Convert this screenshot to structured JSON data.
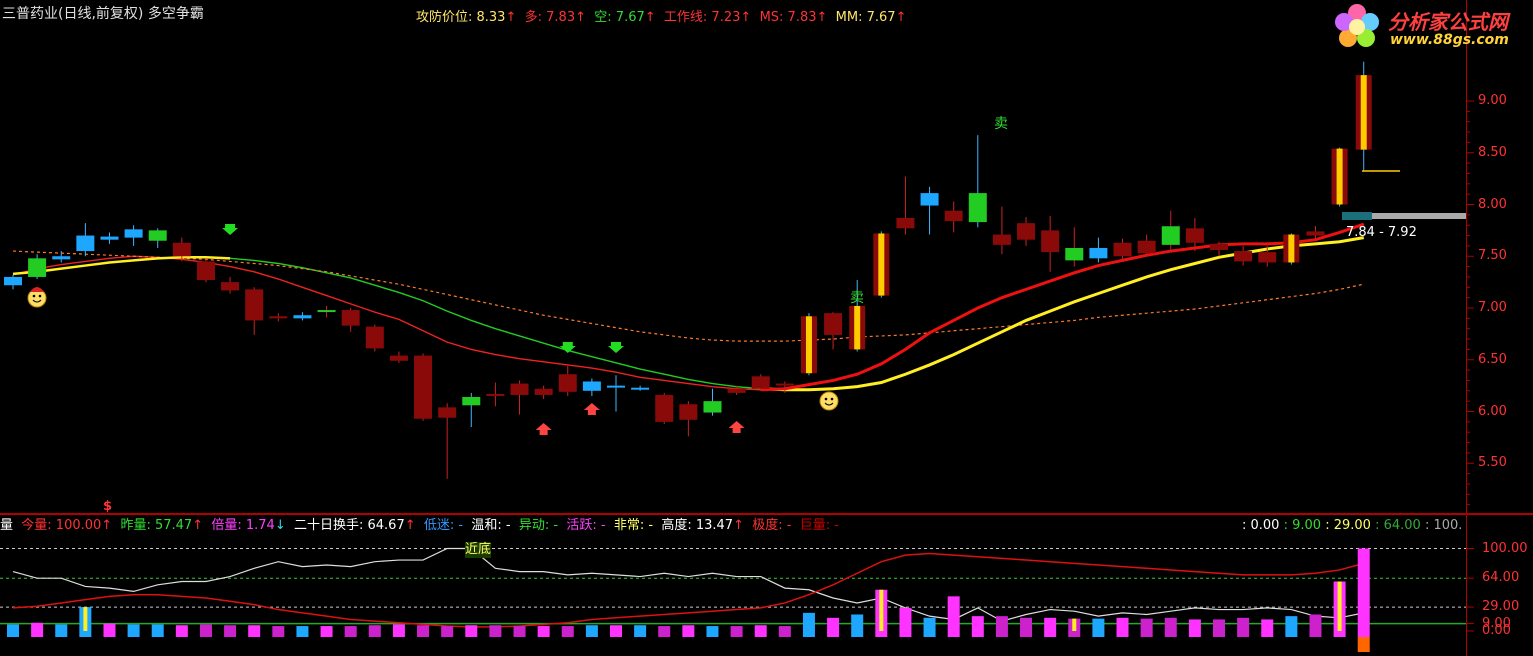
{
  "header": {
    "title": "三普药业(日线,前复权) 多空争霸",
    "indicators": [
      {
        "label": "攻防价位: 8.33",
        "arrow": "↑",
        "color": "#ffe66a"
      },
      {
        "label": "多: 7.83",
        "arrow": "↑",
        "color": "#ff3333"
      },
      {
        "label": "空: 7.67",
        "arrow": "↑",
        "color": "#33dd33"
      },
      {
        "label": "工作线: 7.23",
        "arrow": "↑",
        "color": "#ff3333"
      },
      {
        "label": "MS: 7.83",
        "arrow": "↑",
        "color": "#ff3333"
      },
      {
        "label": "MM: 7.67",
        "arrow": "↑",
        "color": "#ffe66a"
      }
    ]
  },
  "logo": {
    "name": "分析家公式网",
    "url": "www.88gs.com"
  },
  "price_axis": {
    "ticks": [
      "9.00",
      "8.50",
      "8.00",
      "7.50",
      "7.00",
      "6.50",
      "6.00",
      "5.50"
    ]
  },
  "range_label": "7.84 - 7.92",
  "signals": {
    "sell1": "卖",
    "sell2": "卖",
    "dollar": "$",
    "near_bottom": "近底"
  },
  "volume_header": {
    "prefix": "量",
    "items": [
      {
        "label": "今量: 100.00",
        "arrow": "↑",
        "color": "#ff3333",
        "arrow_color": "#ff3333"
      },
      {
        "label": "昨量: 57.47",
        "arrow": "↑",
        "color": "#33dd33",
        "arrow_color": "#ff3333"
      },
      {
        "label": "倍量: 1.74",
        "arrow": "↓",
        "color": "#ff40ff",
        "arrow_color": "#33dddd"
      },
      {
        "label": "二十日换手: 64.67",
        "arrow": "↑",
        "color": "#ffffff",
        "arrow_color": "#ff3333"
      },
      {
        "label": "低迷: -",
        "arrow": "",
        "color": "#3399ff",
        "arrow_color": ""
      },
      {
        "label": "温和: -",
        "arrow": "",
        "color": "#ffffff",
        "arrow_color": ""
      },
      {
        "label": "异动: -",
        "arrow": "",
        "color": "#33dd33",
        "arrow_color": ""
      },
      {
        "label": "活跃: -",
        "arrow": "",
        "color": "#ff40ff",
        "arrow_color": ""
      },
      {
        "label": "非常: -",
        "arrow": "",
        "color": "#ffff66",
        "arrow_color": ""
      },
      {
        "label": "高度: 13.47",
        "arrow": "↑",
        "color": "#ffffff",
        "arrow_color": "#ff3333"
      },
      {
        "label": "极度: -",
        "arrow": "",
        "color": "#ff3333",
        "arrow_color": ""
      },
      {
        "label": "巨量: -",
        "arrow": "",
        "color": "#cc0000",
        "arrow_color": ""
      }
    ],
    "right_values": [
      {
        "label": ": 0.00",
        "color": "#ffffff"
      },
      {
        "label": ": 9.00",
        "color": "#33dd33"
      },
      {
        "label": ": 29.00",
        "color": "#ffff66"
      },
      {
        "label": ": 64.00",
        "color": "#33aa33"
      },
      {
        "label": ": 100.",
        "color": "#aaaaaa"
      }
    ]
  },
  "volume_axis": {
    "ticks": [
      "100.00",
      "64.00",
      "29.00",
      "9.00",
      "0.00"
    ]
  },
  "chart_data": {
    "type": "candlestick",
    "y_range": [
      5.5,
      9.0
    ],
    "candles": [
      {
        "o": 7.22,
        "c": 7.3,
        "h": 7.32,
        "l": 7.18
      },
      {
        "o": 7.3,
        "c": 7.48,
        "h": 7.52,
        "l": 7.28
      },
      {
        "o": 7.47,
        "c": 7.5,
        "h": 7.55,
        "l": 7.44
      },
      {
        "o": 7.55,
        "c": 7.7,
        "h": 7.82,
        "l": 7.5
      },
      {
        "o": 7.66,
        "c": 7.69,
        "h": 7.73,
        "l": 7.62
      },
      {
        "o": 7.68,
        "c": 7.76,
        "h": 7.8,
        "l": 7.6
      },
      {
        "o": 7.65,
        "c": 7.75,
        "h": 7.77,
        "l": 7.58
      },
      {
        "o": 7.63,
        "c": 7.5,
        "h": 7.68,
        "l": 7.45
      },
      {
        "o": 7.45,
        "c": 7.27,
        "h": 7.48,
        "l": 7.25
      },
      {
        "o": 7.25,
        "c": 7.17,
        "h": 7.3,
        "l": 7.14
      },
      {
        "o": 7.18,
        "c": 6.88,
        "h": 7.2,
        "l": 6.74
      },
      {
        "o": 6.92,
        "c": 6.9,
        "h": 6.95,
        "l": 6.87
      },
      {
        "o": 6.9,
        "c": 6.93,
        "h": 6.96,
        "l": 6.88
      },
      {
        "o": 6.98,
        "c": 6.97,
        "h": 7.02,
        "l": 6.91
      },
      {
        "o": 6.98,
        "c": 6.83,
        "h": 7.0,
        "l": 6.77
      },
      {
        "o": 6.82,
        "c": 6.61,
        "h": 6.84,
        "l": 6.58
      },
      {
        "o": 6.54,
        "c": 6.49,
        "h": 6.58,
        "l": 6.47
      },
      {
        "o": 6.54,
        "c": 5.93,
        "h": 6.56,
        "l": 5.91
      },
      {
        "o": 6.04,
        "c": 5.94,
        "h": 6.08,
        "l": 5.35
      },
      {
        "o": 6.06,
        "c": 6.14,
        "h": 6.18,
        "l": 5.85
      },
      {
        "o": 6.17,
        "c": 6.15,
        "h": 6.28,
        "l": 6.05
      },
      {
        "o": 6.27,
        "c": 6.16,
        "h": 6.3,
        "l": 5.97
      },
      {
        "o": 6.22,
        "c": 6.16,
        "h": 6.25,
        "l": 6.12
      },
      {
        "o": 6.36,
        "c": 6.19,
        "h": 6.44,
        "l": 6.15
      },
      {
        "o": 6.2,
        "c": 6.29,
        "h": 6.32,
        "l": 6.15
      },
      {
        "o": 6.24,
        "c": 6.25,
        "h": 6.35,
        "l": 6.0
      },
      {
        "o": 6.22,
        "c": 6.23,
        "h": 6.25,
        "l": 6.2
      },
      {
        "o": 6.16,
        "c": 5.9,
        "h": 6.18,
        "l": 5.88
      },
      {
        "o": 6.07,
        "c": 5.92,
        "h": 6.1,
        "l": 5.76
      },
      {
        "o": 5.99,
        "c": 6.1,
        "h": 6.22,
        "l": 5.96
      },
      {
        "o": 6.22,
        "c": 6.18,
        "h": 6.25,
        "l": 6.16
      },
      {
        "o": 6.34,
        "c": 6.22,
        "h": 6.36,
        "l": 6.2
      },
      {
        "o": 6.27,
        "c": 6.26,
        "h": 6.29,
        "l": 6.18
      },
      {
        "o": 6.37,
        "c": 6.92,
        "h": 6.95,
        "l": 6.35
      },
      {
        "o": 6.95,
        "c": 6.74,
        "h": 6.96,
        "l": 6.6
      },
      {
        "o": 6.6,
        "c": 7.02,
        "h": 7.27,
        "l": 6.58
      },
      {
        "o": 7.12,
        "c": 7.72,
        "h": 7.74,
        "l": 7.1
      },
      {
        "o": 7.87,
        "c": 7.77,
        "h": 8.27,
        "l": 7.71
      },
      {
        "o": 7.99,
        "c": 8.11,
        "h": 8.17,
        "l": 7.71
      },
      {
        "o": 7.94,
        "c": 7.84,
        "h": 8.03,
        "l": 7.73
      },
      {
        "o": 7.83,
        "c": 8.11,
        "h": 8.67,
        "l": 7.78
      },
      {
        "o": 7.71,
        "c": 7.61,
        "h": 7.98,
        "l": 7.52
      },
      {
        "o": 7.82,
        "c": 7.66,
        "h": 7.88,
        "l": 7.6
      },
      {
        "o": 7.75,
        "c": 7.54,
        "h": 7.89,
        "l": 7.35
      },
      {
        "o": 7.58,
        "c": 7.46,
        "h": 7.78,
        "l": 7.4
      },
      {
        "o": 7.48,
        "c": 7.58,
        "h": 7.68,
        "l": 7.44
      },
      {
        "o": 7.63,
        "c": 7.5,
        "h": 7.67,
        "l": 7.45
      },
      {
        "o": 7.65,
        "c": 7.53,
        "h": 7.71,
        "l": 7.5
      },
      {
        "o": 7.79,
        "c": 7.61,
        "h": 7.94,
        "l": 7.55
      },
      {
        "o": 7.77,
        "c": 7.63,
        "h": 7.87,
        "l": 7.55
      },
      {
        "o": 7.62,
        "c": 7.56,
        "h": 7.64,
        "l": 7.5
      },
      {
        "o": 7.55,
        "c": 7.45,
        "h": 7.6,
        "l": 7.41
      },
      {
        "o": 7.54,
        "c": 7.44,
        "h": 7.6,
        "l": 7.4
      },
      {
        "o": 7.44,
        "c": 7.71,
        "h": 7.72,
        "l": 7.42
      },
      {
        "o": 7.74,
        "c": 7.7,
        "h": 7.79,
        "l": 7.65
      },
      {
        "o": 8.0,
        "c": 8.54,
        "h": 8.55,
        "l": 7.98
      },
      {
        "o": 8.53,
        "c": 9.25,
        "h": 9.38,
        "l": 8.33
      }
    ],
    "series": [
      {
        "name": "多",
        "values": [
          7.32,
          7.38,
          7.42,
          7.45,
          7.48,
          7.5,
          7.49,
          7.47,
          7.44,
          7.4,
          7.35,
          7.28,
          7.2,
          7.12,
          7.04,
          6.96,
          6.89,
          6.78,
          6.67,
          6.6,
          6.55,
          6.51,
          6.48,
          6.45,
          6.42,
          6.38,
          6.33,
          6.3,
          6.27,
          6.24,
          6.22,
          6.21,
          6.22,
          6.26,
          6.3,
          6.36,
          6.46,
          6.6,
          6.76,
          6.88,
          7.0,
          7.1,
          7.18,
          7.26,
          7.34,
          7.41,
          7.46,
          7.51,
          7.55,
          7.58,
          7.61,
          7.62,
          7.62,
          7.63,
          7.66,
          7.73,
          7.81
        ]
      },
      {
        "name": "空",
        "values": [
          7.33,
          7.35,
          7.38,
          7.41,
          7.44,
          7.46,
          7.48,
          7.49,
          7.49,
          7.48,
          7.46,
          7.43,
          7.39,
          7.34,
          7.29,
          7.22,
          7.15,
          7.07,
          6.97,
          6.88,
          6.8,
          6.73,
          6.66,
          6.59,
          6.53,
          6.47,
          6.41,
          6.36,
          6.31,
          6.27,
          6.24,
          6.22,
          6.21,
          6.21,
          6.22,
          6.24,
          6.28,
          6.36,
          6.45,
          6.55,
          6.66,
          6.77,
          6.88,
          6.97,
          7.06,
          7.14,
          7.22,
          7.3,
          7.37,
          7.43,
          7.49,
          7.53,
          7.57,
          7.6,
          7.62,
          7.64,
          7.68
        ]
      },
      {
        "name": "工作线",
        "values": [
          7.55,
          7.54,
          7.53,
          7.52,
          7.51,
          7.5,
          7.49,
          7.48,
          7.47,
          7.45,
          7.43,
          7.41,
          7.38,
          7.35,
          7.31,
          7.27,
          7.23,
          7.18,
          7.13,
          7.08,
          7.03,
          6.98,
          6.93,
          6.89,
          6.85,
          6.81,
          6.77,
          6.74,
          6.71,
          6.69,
          6.68,
          6.68,
          6.68,
          6.69,
          6.7,
          6.72,
          6.73,
          6.74,
          6.76,
          6.78,
          6.8,
          6.82,
          6.84,
          6.86,
          6.88,
          6.91,
          6.93,
          6.95,
          6.97,
          6.99,
          7.02,
          7.05,
          7.08,
          7.11,
          7.14,
          7.18,
          7.23
        ]
      }
    ]
  }
}
